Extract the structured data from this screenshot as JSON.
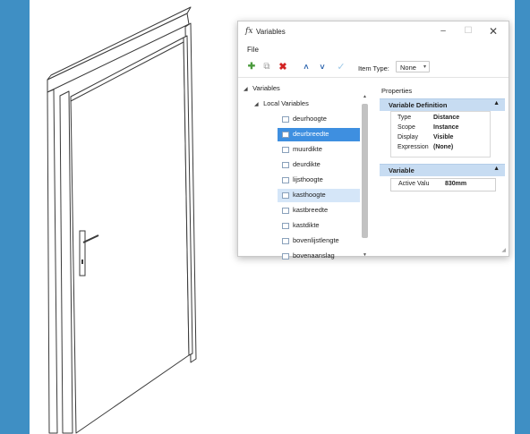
{
  "dialog": {
    "title_icon": "fx",
    "title": "Variables",
    "window_controls": {
      "minimize": "–",
      "maximize": "☐",
      "close": "✕"
    },
    "menu": {
      "file": "File"
    },
    "toolbar": {
      "new_icon": "✚",
      "copy_icon": "⧉",
      "delete_icon": "✖",
      "up_icon": "˄",
      "down_icon": "˅",
      "check_icon": "✓",
      "item_type_label": "Item Type:",
      "item_type_value": "None",
      "item_type_caret": "▾"
    },
    "tree": {
      "root": {
        "label": "Variables",
        "caret": "◢"
      },
      "group": {
        "label": "Local Variables",
        "caret": "◢"
      },
      "items": [
        {
          "label": "deurhoogte"
        },
        {
          "label": "deurbreedte"
        },
        {
          "label": "muurdikte"
        },
        {
          "label": "deurdikte"
        },
        {
          "label": "lijsthoogte"
        },
        {
          "label": "kasthoogte"
        },
        {
          "label": "kastbreedte"
        },
        {
          "label": "kastdikte"
        },
        {
          "label": "bovenlijstlengte"
        },
        {
          "label": "bovenaanslag"
        }
      ],
      "selected_index": 1,
      "highlighted_index": 5,
      "scroll_up": "▲",
      "scroll_down": "▼"
    },
    "properties": {
      "title": "Properties",
      "definition_section": {
        "title": "Variable Definition",
        "caret": "▲",
        "rows": [
          {
            "key": "Type",
            "value": "Distance"
          },
          {
            "key": "Scope",
            "value": "Instance"
          },
          {
            "key": "Display",
            "value": "Visible"
          },
          {
            "key": "Expression",
            "value": "(None)"
          }
        ]
      },
      "variable_section": {
        "title": "Variable",
        "caret": "▲",
        "active_value_label": "Active Valu",
        "active_value": "830mm"
      },
      "resize_grip": "◢"
    },
    "colors": {
      "selection": "#3e8fe0",
      "highlight": "#d5e6f8",
      "section_header": "#c7dcf2",
      "background_frame": "#3f8fc4"
    }
  },
  "drawing": {
    "subject": "door-frame-isometric"
  }
}
